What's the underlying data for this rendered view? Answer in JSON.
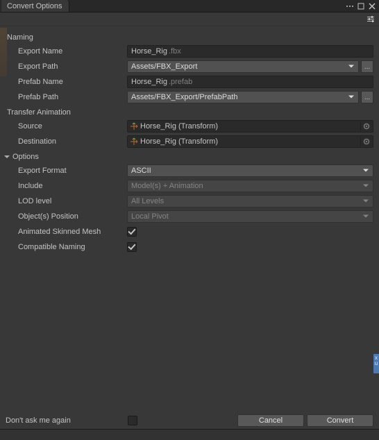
{
  "window": {
    "tab_title": "Convert Options"
  },
  "sections": {
    "naming": "Naming",
    "transfer": "Transfer Animation",
    "options": "Options"
  },
  "naming": {
    "export_name_label": "Export Name",
    "export_name_value": "Horse_Rig",
    "export_name_suffix": ".fbx",
    "export_path_label": "Export Path",
    "export_path_value": "Assets/FBX_Export",
    "prefab_name_label": "Prefab Name",
    "prefab_name_value": "Horse_Rig",
    "prefab_name_suffix": ".prefab",
    "prefab_path_label": "Prefab Path",
    "prefab_path_value": "Assets/FBX_Export/PrefabPath"
  },
  "transfer": {
    "source_label": "Source",
    "source_value": "Horse_Rig (Transform)",
    "destination_label": "Destination",
    "destination_value": "Horse_Rig (Transform)"
  },
  "options": {
    "export_format_label": "Export Format",
    "export_format_value": "ASCII",
    "include_label": "Include",
    "include_value": "Model(s) + Animation",
    "lod_label": "LOD level",
    "lod_value": "All Levels",
    "position_label": "Object(s) Position",
    "position_value": "Local Pivot",
    "anim_mesh_label": "Animated Skinned Mesh",
    "compat_label": "Compatible Naming"
  },
  "footer": {
    "dont_ask": "Don't ask me again",
    "cancel": "Cancel",
    "convert": "Convert"
  },
  "browse_label": "..."
}
